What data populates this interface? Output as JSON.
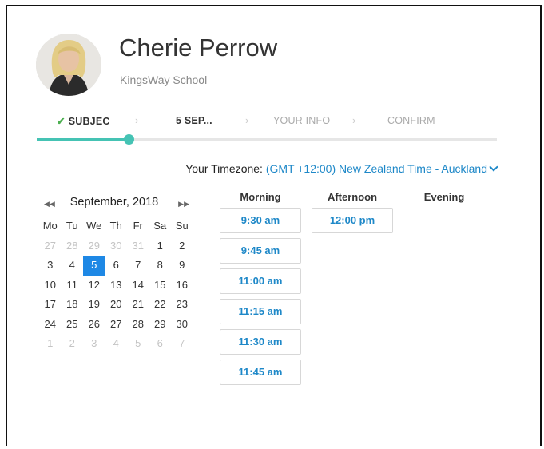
{
  "profile": {
    "name": "Cherie Perrow",
    "organization": "KingsWay School",
    "avatar_icon": "person-photo"
  },
  "steps": [
    {
      "label": "SUBJEC",
      "state": "done"
    },
    {
      "label": "5 SEP...",
      "state": "active"
    },
    {
      "label": "YOUR INFO",
      "state": "todo"
    },
    {
      "label": "CONFIRM",
      "state": "todo"
    }
  ],
  "progress_fraction": 0.2,
  "timezone": {
    "label": "Your Timezone:",
    "value": "(GMT +12:00) New Zealand Time - Auckland"
  },
  "calendar": {
    "month_label": "September, 2018",
    "weekdays": [
      "Mo",
      "Tu",
      "We",
      "Th",
      "Fr",
      "Sa",
      "Su"
    ],
    "weeks": [
      [
        "27",
        "28",
        "29",
        "30",
        "31",
        "1",
        "2"
      ],
      [
        "3",
        "4",
        "5",
        "6",
        "7",
        "8",
        "9"
      ],
      [
        "10",
        "11",
        "12",
        "13",
        "14",
        "15",
        "16"
      ],
      [
        "17",
        "18",
        "19",
        "20",
        "21",
        "22",
        "23"
      ],
      [
        "24",
        "25",
        "26",
        "27",
        "28",
        "29",
        "30"
      ],
      [
        "1",
        "2",
        "3",
        "4",
        "5",
        "6",
        "7"
      ]
    ],
    "selected_day": "5"
  },
  "times": {
    "morning_label": "Morning",
    "afternoon_label": "Afternoon",
    "evening_label": "Evening",
    "morning": [
      "9:30 am",
      "9:45 am",
      "11:00 am",
      "11:15 am",
      "11:30 am",
      "11:45 am"
    ],
    "afternoon": [
      "12:00 pm"
    ],
    "evening": []
  },
  "colors": {
    "accent": "#1e88c8",
    "progress": "#45c3b4",
    "selected_day": "#1e88e5",
    "check": "#4caf50"
  }
}
